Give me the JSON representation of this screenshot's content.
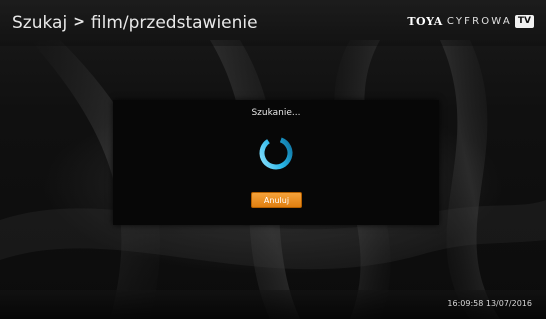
{
  "header": {
    "breadcrumb_root": "Szukaj",
    "breadcrumb_separator": ">",
    "breadcrumb_current": "film/przedstawienie",
    "logo": {
      "brand": "TOYA",
      "product": "CYFROWA",
      "badge": "TV"
    }
  },
  "dialog": {
    "title": "Szukanie...",
    "spinner_icon": "loading-spinner-icon",
    "cancel_label": "Anuluj"
  },
  "footer": {
    "clock": "16:09:58 13/07/2016"
  },
  "colors": {
    "accent_orange": "#f0901f",
    "spinner_cyan": "#29b6e8",
    "dialog_background": "#070707"
  }
}
